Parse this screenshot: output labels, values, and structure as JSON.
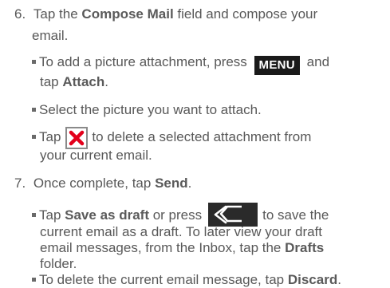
{
  "step6": {
    "number": "6.",
    "pre": "Tap the ",
    "field": "Compose Mail",
    "post": " field and compose your",
    "line2": "email.",
    "bullet1": {
      "pre": "To add a picture attachment, press",
      "key": "MENU",
      "post": "and",
      "line2_pre": "tap ",
      "line2_bold": "Attach",
      "line2_post": "."
    },
    "bullet2": {
      "text": "Select the picture you want to attach."
    },
    "bullet3": {
      "pre": "Tap",
      "post": "to delete a selected attachment from",
      "line2": "your current email."
    }
  },
  "step7": {
    "number": "7.",
    "pre": "Once complete, tap ",
    "bold": "Send",
    "post": ".",
    "bullet1": {
      "pre": "Tap ",
      "bold1": "Save as draft",
      "mid": " or press",
      "post": "to save the",
      "line2": "current email as a draft. To later view your draft",
      "line3_pre": "email messages, from the Inbox, tap the ",
      "line3_bold": "Drafts",
      "line4": "folder."
    },
    "bullet2": {
      "pre": "To delete the current email message, tap ",
      "bold": "Discard",
      "post": "."
    }
  },
  "icons": {
    "menu_key": "menu-key",
    "delete": "close-icon",
    "back": "back-icon"
  },
  "colors": {
    "text": "#585858",
    "delete_red": "#e3001b",
    "key_bg": "#1a1a1a"
  }
}
